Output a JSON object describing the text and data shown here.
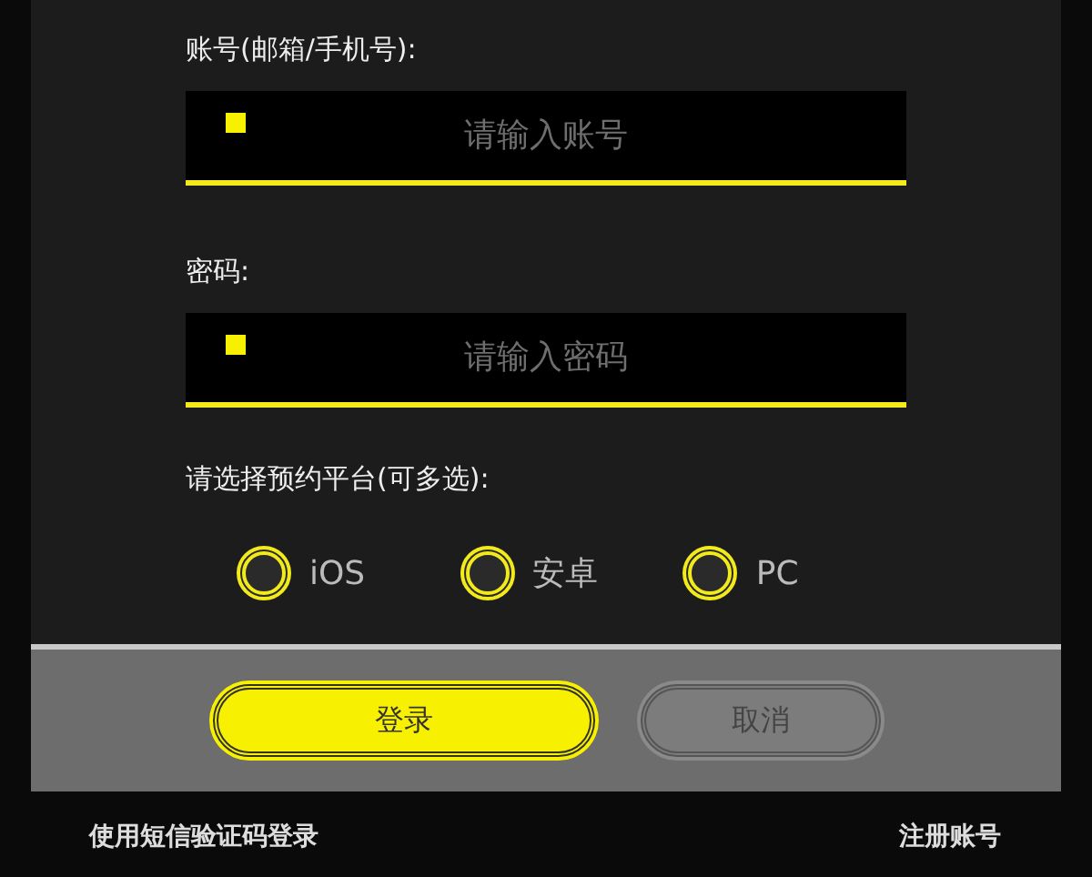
{
  "account": {
    "label": "账号(邮箱/手机号):",
    "placeholder": "请输入账号"
  },
  "password": {
    "label": "密码:",
    "placeholder": "请输入密码"
  },
  "platforms": {
    "label": "请选择预约平台(可多选):",
    "options": [
      {
        "label": "iOS",
        "selected": false
      },
      {
        "label": "安卓",
        "selected": false
      },
      {
        "label": "PC",
        "selected": false
      }
    ]
  },
  "buttons": [
    {
      "label": "登录",
      "kind": "primary"
    },
    {
      "label": "取消",
      "kind": "secondary"
    }
  ],
  "links": [
    {
      "label": "使用短信验证码登录"
    },
    {
      "label": "注册账号"
    }
  ]
}
